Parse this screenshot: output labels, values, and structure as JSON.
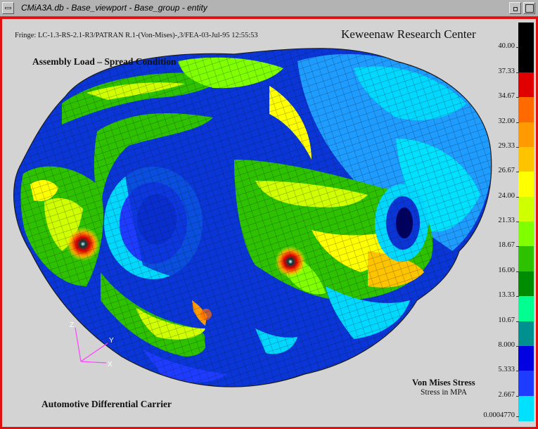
{
  "window": {
    "title": "CMiA3A.db - Base_viewport - Base_group - entity"
  },
  "viewport": {
    "fringe_header": "Fringe: LC-1.3-RS-2.1-R3/PATRAN R.1-(Von-Mises)-,3/FEA-03-Jul-95 12:55:53",
    "organization": "Keweenaw Research Center",
    "subtitle": "Assembly Load – Spread Condition",
    "part_name": "Automotive Differential Carrier",
    "result_title": "Von Mises Stress",
    "result_units": "Stress in MPA"
  },
  "axis_triad": {
    "z": "Z",
    "y": "Y",
    "x": "X"
  },
  "legend": {
    "labels": [
      "40.00",
      "37.33",
      "34.67",
      "32.00",
      "29.33",
      "26.67",
      "24.00",
      "21.33",
      "18.67",
      "16.00",
      "13.33",
      "10.67",
      "8.000",
      "5.333",
      "2.667",
      "0.0004770"
    ],
    "band_colors": [
      "#000000",
      "#000000",
      "#e00000",
      "#ff6a00",
      "#ff9a00",
      "#ffc400",
      "#ffff00",
      "#cfff00",
      "#7fff00",
      "#2ec100",
      "#008c00",
      "#00ff90",
      "#009090",
      "#0000e0",
      "#1e3cff",
      "#00e0ff"
    ]
  },
  "colors": {
    "frame": "#e01010",
    "background": "#d3d3d3",
    "titlebar": "#b3b3b3"
  }
}
